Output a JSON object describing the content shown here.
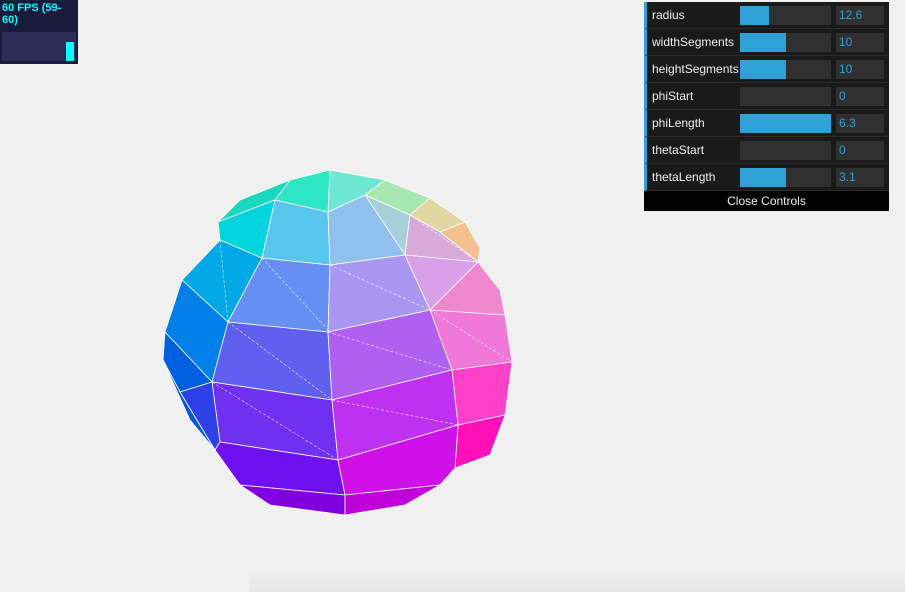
{
  "fps": {
    "label": "60 FPS (59-60)",
    "bar_level": 0.65
  },
  "gui": {
    "controls": [
      {
        "label": "radius",
        "value": "12.6",
        "fill": 0.32
      },
      {
        "label": "widthSegments",
        "value": "10",
        "fill": 0.5
      },
      {
        "label": "heightSegments",
        "value": "10",
        "fill": 0.5
      },
      {
        "label": "phiStart",
        "value": "0",
        "fill": 0.0
      },
      {
        "label": "phiLength",
        "value": "6.3",
        "fill": 1.0
      },
      {
        "label": "thetaStart",
        "value": "0",
        "fill": 0.0
      },
      {
        "label": "thetaLength",
        "value": "3.1",
        "fill": 0.5
      }
    ],
    "close_label": "Close Controls"
  },
  "colors": {
    "background": "#f0f0f0",
    "accent": "#2fa1d6",
    "panel": "#1a1a1a",
    "fps_text": "#00ffff"
  }
}
